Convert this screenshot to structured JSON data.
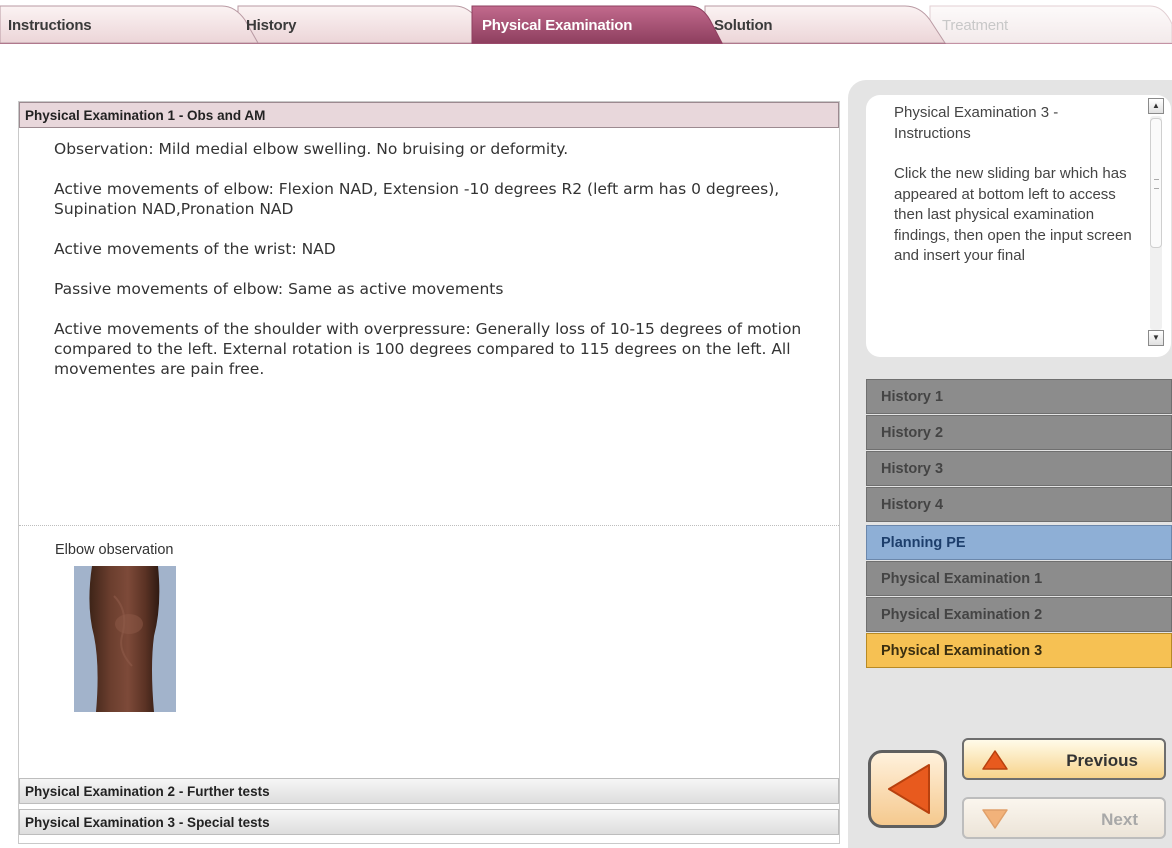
{
  "tabs": [
    {
      "label": "Instructions",
      "state": "normal"
    },
    {
      "label": "History",
      "state": "normal"
    },
    {
      "label": "Physical Examination",
      "state": "active"
    },
    {
      "label": "Solution",
      "state": "normal"
    },
    {
      "label": "Treatment",
      "state": "disabled"
    }
  ],
  "main": {
    "section1_title": "Physical Examination 1 - Obs and AM",
    "paragraphs": [
      "Observation: Mild medial elbow swelling. No bruising or deformity.",
      "Active movements of elbow: Flexion NAD, Extension -10 degrees R2 (left arm has 0 degrees), Supination NAD,Pronation NAD",
      "Active movements of the wrist: NAD",
      "Passive movements of elbow: Same as active movements",
      "Active movements of the shoulder with overpressure: Generally loss of 10-15 degrees of motion compared to the left. External rotation is 100 degrees compared to 115 degrees on the left. All movementes are pain free."
    ],
    "image_caption": "Elbow observation",
    "section2_title": "Physical Examination 2 - Further tests",
    "section3_title": "Physical Examination 3 - Special tests"
  },
  "instructions": {
    "title": "Physical Examination 3 - Instructions",
    "body": "Click the new sliding bar which has appeared at bottom left to access then last physical examination findings, then open the input screen and insert your final"
  },
  "nav": [
    {
      "label": "History 1",
      "state": "grey"
    },
    {
      "label": "History 2",
      "state": "grey"
    },
    {
      "label": "History 3",
      "state": "grey"
    },
    {
      "label": "History 4",
      "state": "grey"
    },
    {
      "label": "Planning PE",
      "state": "blue"
    },
    {
      "label": "Physical Examination 1",
      "state": "grey"
    },
    {
      "label": "Physical Examination 2",
      "state": "grey"
    },
    {
      "label": "Physical Examination 3",
      "state": "active"
    }
  ],
  "buttons": {
    "previous": "Previous",
    "next": "Next"
  },
  "colors": {
    "active_tab": "#a65577",
    "highlight": "#f6c153",
    "planning": "#8eafd6",
    "arrow": "#e85a1e"
  }
}
